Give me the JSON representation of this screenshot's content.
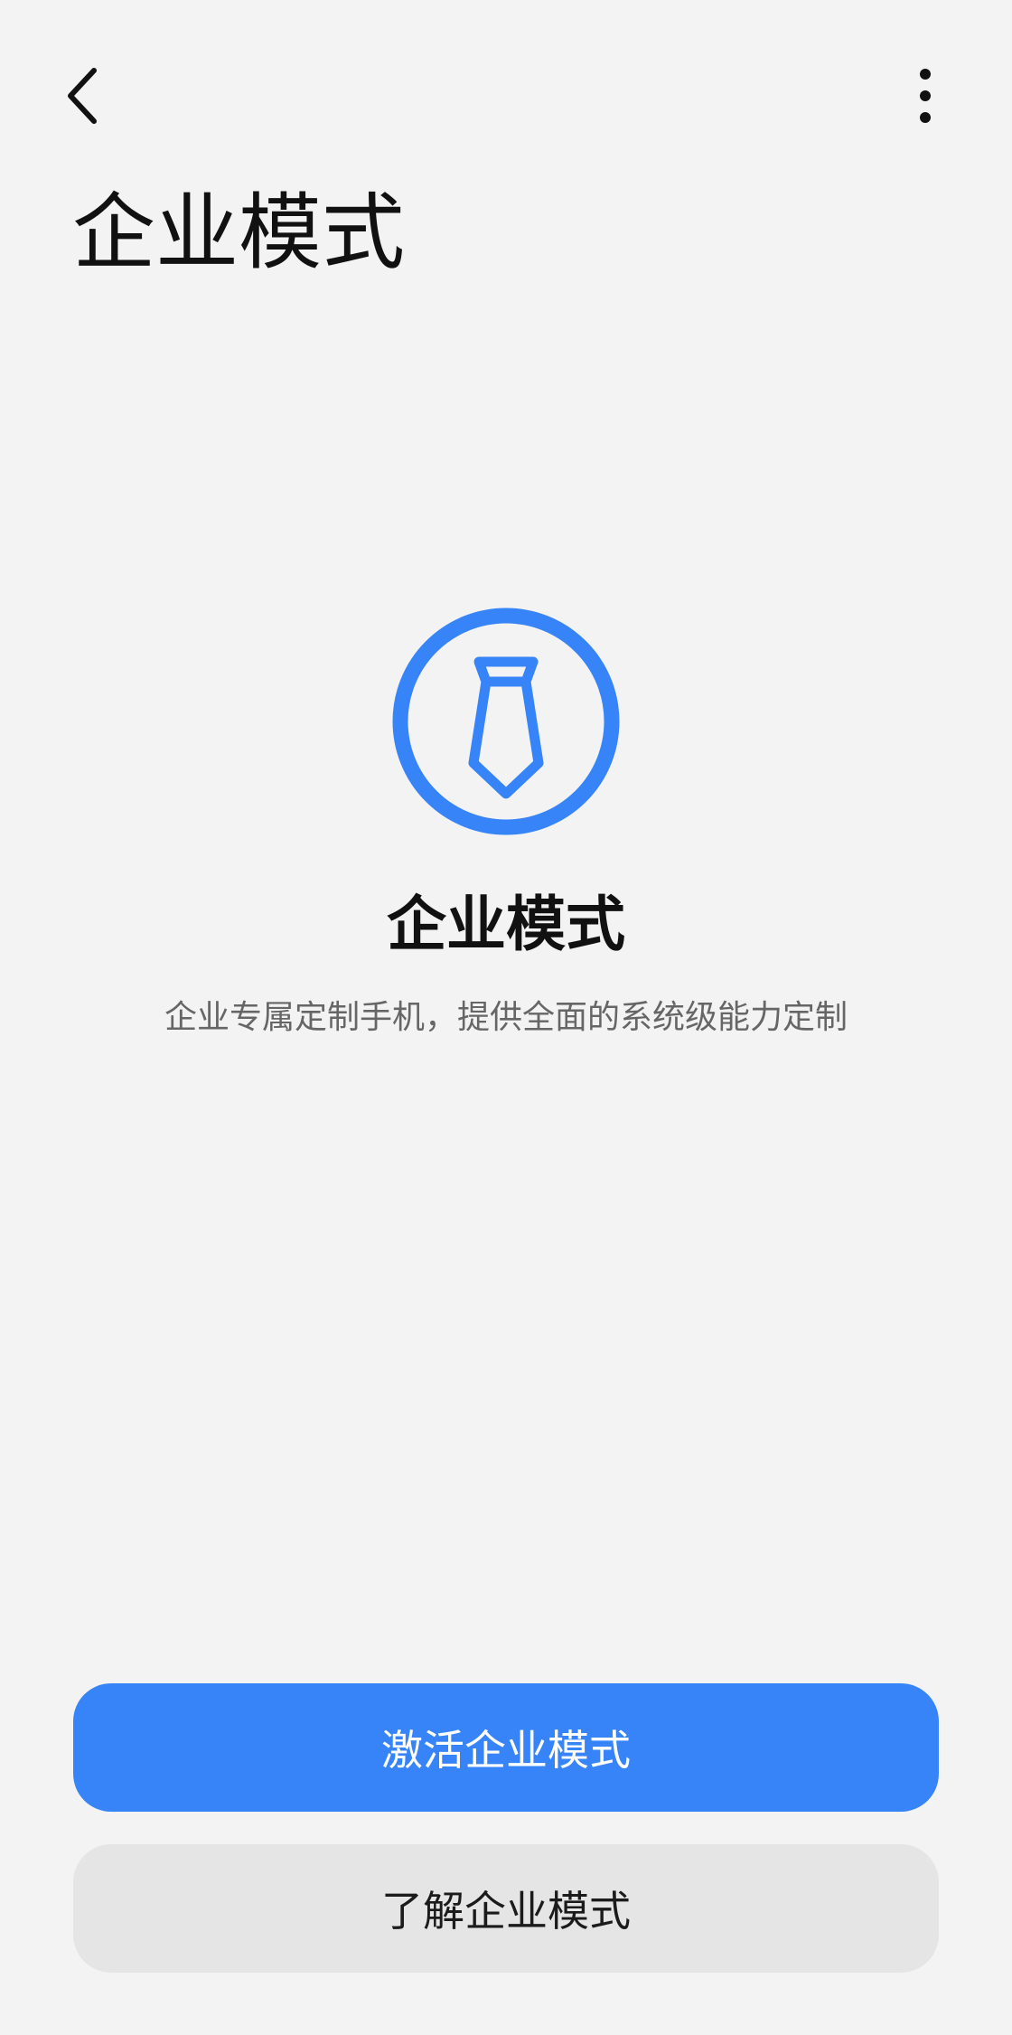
{
  "header": {
    "back_icon": "chevron-left-icon",
    "more_icon": "more-vertical-icon",
    "title": "企业模式"
  },
  "hero": {
    "icon": "tie-icon",
    "icon_color": "#3784f9",
    "title": "企业模式",
    "description": "企业专属定制手机，提供全面的系统级能力定制"
  },
  "actions": {
    "activate_label": "激活企业模式",
    "learn_label": "了解企业模式",
    "primary_color": "#3784f9",
    "secondary_color": "#e5e5e5"
  }
}
